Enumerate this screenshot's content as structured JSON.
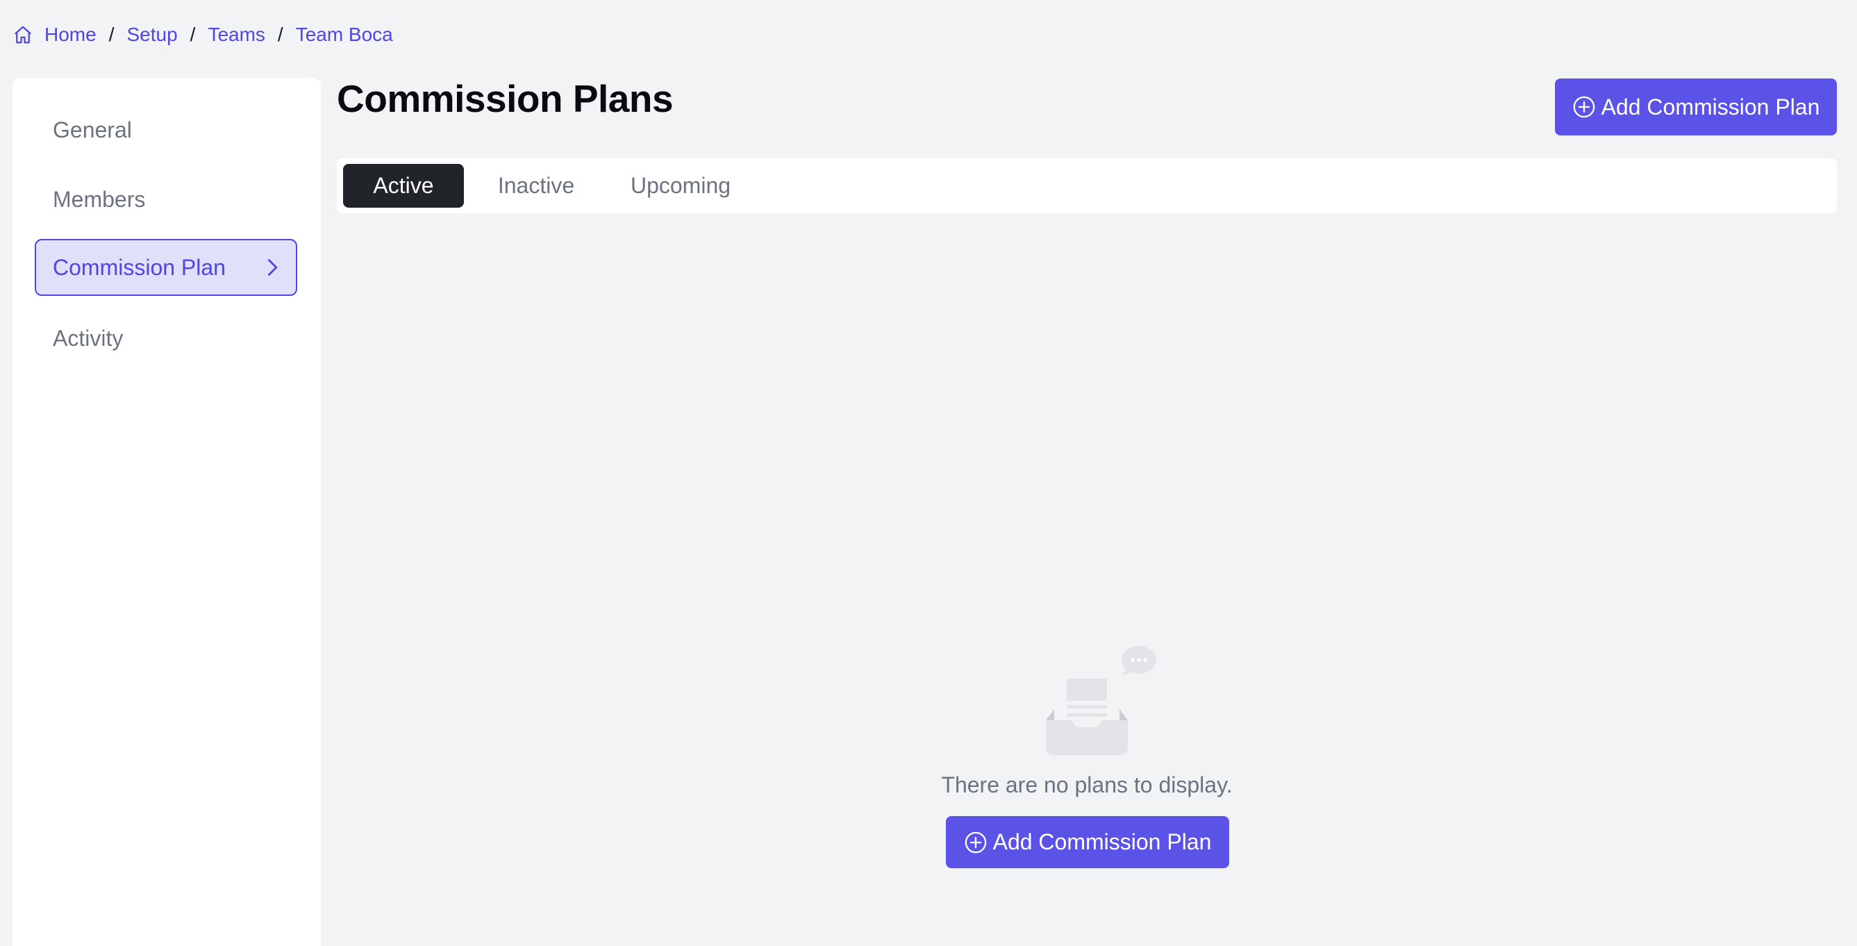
{
  "breadcrumb": {
    "items": [
      "Home",
      "Setup",
      "Teams",
      "Team Boca"
    ],
    "separator": "/"
  },
  "sidebar": {
    "items": [
      {
        "label": "General",
        "active": false
      },
      {
        "label": "Members",
        "active": false
      },
      {
        "label": "Commission Plan",
        "active": true
      },
      {
        "label": "Activity",
        "active": false
      }
    ]
  },
  "main": {
    "title": "Commission Plans",
    "add_button_label": "Add Commission Plan",
    "tabs": [
      {
        "label": "Active",
        "active": true
      },
      {
        "label": "Inactive",
        "active": false
      },
      {
        "label": "Upcoming",
        "active": false
      }
    ],
    "empty_state": {
      "message": "There are no plans to display.",
      "button_label": "Add Commission Plan",
      "icon": "empty-inbox-icon"
    }
  },
  "colors": {
    "accent": "#4f46e5",
    "button": "#5b52e8",
    "active_tab": "#212529",
    "background": "#f2f3f5"
  }
}
